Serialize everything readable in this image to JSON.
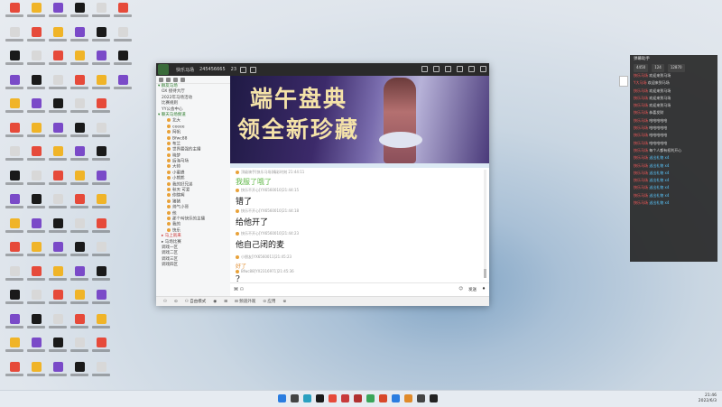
{
  "window": {
    "group_name": "快乐马场",
    "group_id": "245456665",
    "member_count": "23"
  },
  "banner": {
    "line1": "端午盘典",
    "line2": "领全新珍藏"
  },
  "sidebar": {
    "channels": [
      {
        "label": "▾ 群友马场",
        "kind": "cat"
      },
      {
        "label": "OX 接待大厅",
        "kind": "ch"
      },
      {
        "label": "2022年马场活动",
        "kind": "ch"
      },
      {
        "label": "比赛规则",
        "kind": "ch"
      },
      {
        "label": "YY公会中心",
        "kind": "ch"
      },
      {
        "label": "▾ 聊天马场频道",
        "kind": "cat"
      },
      {
        "label": "北大",
        "kind": "voice"
      },
      {
        "label": "ceeee",
        "kind": "voice"
      },
      {
        "label": "阿帆",
        "kind": "voice"
      },
      {
        "label": "Bfwc88",
        "kind": "voice"
      },
      {
        "label": "布兰",
        "kind": "voice"
      },
      {
        "label": "世界最强的主播",
        "kind": "voice"
      },
      {
        "label": "晓梦",
        "kind": "voice"
      },
      {
        "label": "后海马场",
        "kind": "voice"
      },
      {
        "label": "大帅",
        "kind": "voice"
      },
      {
        "label": "小蜜蜂",
        "kind": "voice"
      },
      {
        "label": "小熊熊",
        "kind": "voice"
      },
      {
        "label": "我的好兄弟",
        "kind": "voice"
      },
      {
        "label": "秋天 可爱",
        "kind": "voice"
      },
      {
        "label": "你瞎啊",
        "kind": "voice"
      },
      {
        "label": "猪猪",
        "kind": "voice"
      },
      {
        "label": "帅气小哥",
        "kind": "voice"
      },
      {
        "label": "他",
        "kind": "voice"
      },
      {
        "label": "那个叫快乐的主播",
        "kind": "voice"
      },
      {
        "label": "我的",
        "kind": "voice"
      },
      {
        "label": "快乐",
        "kind": "voice"
      },
      {
        "label": "▸ 马上就来",
        "kind": "sel"
      },
      {
        "label": "▸ 马场比赛",
        "kind": "ch"
      },
      {
        "label": "调戏一区",
        "kind": "ch"
      },
      {
        "label": "调戏二区",
        "kind": "ch"
      },
      {
        "label": "调戏三区",
        "kind": "ch"
      },
      {
        "label": "调戏四区",
        "kind": "ch"
      }
    ]
  },
  "messages": [
    {
      "meta": "顶级骑手[快乐马场]精彩时刻 21:44:11",
      "text": "我服了哦了",
      "style": "green"
    },
    {
      "meta": "快乐不开心[YX6560010]21:44:15",
      "text": "错了",
      "style": "normal"
    },
    {
      "meta": "快乐不开心[YX6560010]21:44:18",
      "text": "给他开了",
      "style": "normal"
    },
    {
      "meta": "快乐不开心[YX6560010]21:44:23",
      "text": "他自己闭的麦",
      "style": "normal"
    },
    {
      "meta": "小朋友[YX6560011]21:45:23",
      "text": "好了",
      "style": "orange"
    },
    {
      "meta": "Bfwc88[YX2316971]21:45:36",
      "text": "?",
      "style": "normal"
    }
  ],
  "input": {
    "cmd": "⌘ ⚇",
    "send_label": "发送"
  },
  "footer": {
    "items": [
      "⚇",
      "⊙",
      "⚇ 自由模式",
      "◉",
      "⊞",
      "⊟ 频道外观",
      "⊙ 应用",
      "⊚"
    ]
  },
  "overlay": {
    "title": "弹幕助手",
    "stats": [
      "4450",
      "124",
      "12870"
    ],
    "rows": [
      {
        "name": "快乐马场",
        "text": "欢迎来到马场"
      },
      {
        "name": "Y大马场",
        "text": "欢迎来到马场"
      },
      {
        "name": "快乐马场",
        "text": "欢迎来到马场"
      },
      {
        "name": "快乐马场",
        "text": "欢迎来到马场"
      },
      {
        "name": "快乐马场",
        "text": "欢迎来到马场"
      },
      {
        "name": "快乐马场",
        "text": "恭喜发财"
      },
      {
        "name": "快乐马场",
        "text": "哈哈哈哈哈"
      },
      {
        "name": "快乐马场",
        "text": "哈哈哈哈哈"
      },
      {
        "name": "快乐马场",
        "text": "哈哈哈哈哈"
      },
      {
        "name": "快乐马场",
        "text": "哈哈哈哈哈"
      },
      {
        "name": "快乐马场",
        "text": "每个人都有权利开心"
      },
      {
        "name": "快乐马场",
        "text": "送出礼物 x4",
        "gift": true
      },
      {
        "name": "快乐马场",
        "text": "送出礼物 x4",
        "gift": true
      },
      {
        "name": "快乐马场",
        "text": "送出礼物 x4",
        "gift": true
      },
      {
        "name": "快乐马场",
        "text": "送出礼物 x4",
        "gift": true
      },
      {
        "name": "快乐马场",
        "text": "送出礼物 x4",
        "gift": true
      },
      {
        "name": "快乐马场",
        "text": "送出礼物 x4",
        "gift": true
      },
      {
        "name": "快乐马场",
        "text": "送出礼物 x4",
        "gift": true
      }
    ]
  },
  "taskbar": {
    "time": "21:46",
    "date": "2022/6/3"
  },
  "colors": {
    "titlebar": "#2a2a2a",
    "accent_green": "#62b84a",
    "overlay_bg": "#232323"
  }
}
